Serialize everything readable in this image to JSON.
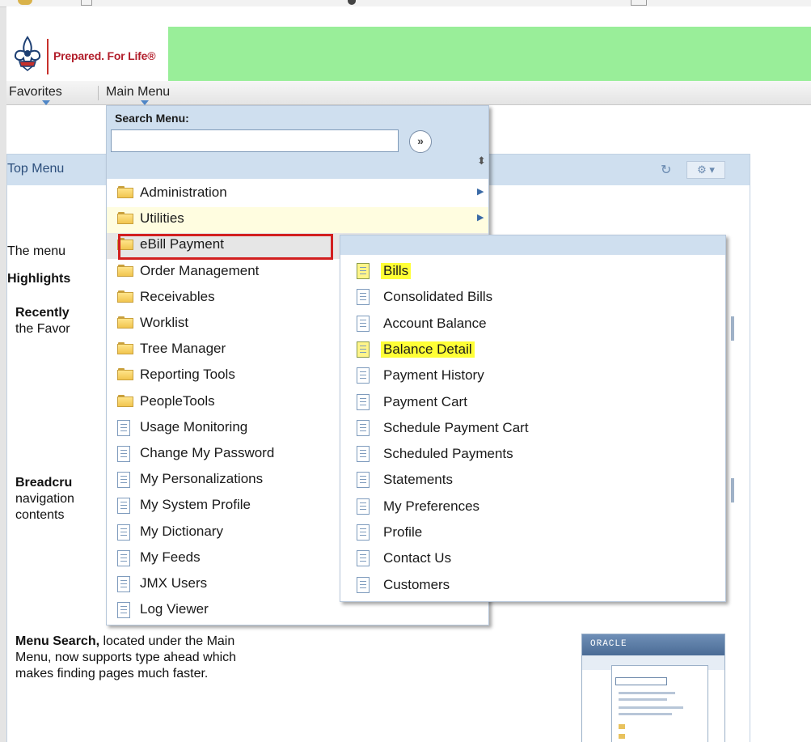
{
  "banner": {
    "tagline": "Prepared. For Life®"
  },
  "menubar": {
    "favorites": "Favorites",
    "main_menu": "Main Menu"
  },
  "search": {
    "label": "Search Menu:",
    "value": "",
    "button": "»"
  },
  "top_menu": {
    "title": "Top Menu",
    "text_menu": "The menu",
    "highlights": "Highlights",
    "recently_bold": "Recently",
    "recently_rest": "the Favor",
    "breadcrumbs_bold": "Breadcru",
    "breadcrumbs_line2": "navigation",
    "breadcrumbs_line3": "contents",
    "menu_search_bold": "Menu Search,",
    "menu_search_line1": " located under the Main",
    "menu_search_line2": "Menu, now supports type ahead which",
    "menu_search_line3": "makes finding pages much faster.",
    "oracle_logo": "ORACLE"
  },
  "main_menu_items": [
    {
      "label": "Administration",
      "icon": "folder-icon",
      "submenu": true
    },
    {
      "label": "Utilities",
      "icon": "folder-icon",
      "submenu": true
    },
    {
      "label": "eBill Payment",
      "icon": "folder-icon",
      "submenu": false
    },
    {
      "label": "Order Management",
      "icon": "folder-icon",
      "submenu": false
    },
    {
      "label": "Receivables",
      "icon": "folder-icon",
      "submenu": false
    },
    {
      "label": "Worklist",
      "icon": "folder-icon",
      "submenu": false
    },
    {
      "label": "Tree Manager",
      "icon": "folder-icon",
      "submenu": false
    },
    {
      "label": "Reporting Tools",
      "icon": "folder-icon",
      "submenu": false
    },
    {
      "label": "PeopleTools",
      "icon": "folder-icon",
      "submenu": false
    },
    {
      "label": "Usage Monitoring",
      "icon": "page-icon",
      "submenu": false
    },
    {
      "label": "Change My Password",
      "icon": "page-icon",
      "submenu": false
    },
    {
      "label": "My Personalizations",
      "icon": "page-icon",
      "submenu": false
    },
    {
      "label": "My System Profile",
      "icon": "page-icon",
      "submenu": false
    },
    {
      "label": "My Dictionary",
      "icon": "page-icon",
      "submenu": false
    },
    {
      "label": "My Feeds",
      "icon": "page-icon",
      "submenu": false
    },
    {
      "label": "JMX Users",
      "icon": "page-icon",
      "submenu": false
    },
    {
      "label": "Log Viewer",
      "icon": "page-icon",
      "submenu": false
    }
  ],
  "ebill_submenu_items": [
    {
      "label": "Bills",
      "highlighted": true
    },
    {
      "label": "Consolidated Bills",
      "highlighted": false
    },
    {
      "label": "Account Balance",
      "highlighted": false
    },
    {
      "label": "Balance Detail",
      "highlighted": true
    },
    {
      "label": "Payment History",
      "highlighted": false
    },
    {
      "label": "Payment Cart",
      "highlighted": false
    },
    {
      "label": "Schedule Payment Cart",
      "highlighted": false
    },
    {
      "label": "Scheduled Payments",
      "highlighted": false
    },
    {
      "label": "Statements",
      "highlighted": false
    },
    {
      "label": "My Preferences",
      "highlighted": false
    },
    {
      "label": "Profile",
      "highlighted": false
    },
    {
      "label": "Contact Us",
      "highlighted": false
    },
    {
      "label": "Customers",
      "highlighted": false
    }
  ],
  "colors": {
    "banner_green": "#99ee99",
    "header_blue": "#cfdfef",
    "highlight_yellow": "#ffff36",
    "selection_red": "#d21f1f"
  }
}
